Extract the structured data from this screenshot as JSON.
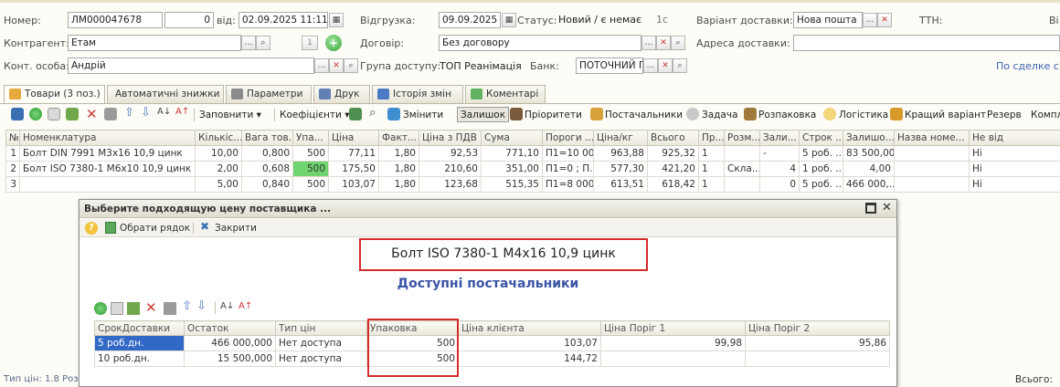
{
  "header": {
    "number_label": "Номер:",
    "number_value": "ЛМ000047678",
    "number_counter": "0",
    "date_label": "від:",
    "date_value": "02.09.2025 11:11:52",
    "shipment_label": "Відгрузка:",
    "shipment_value": "09.09.2025",
    "status_label": "Статус:",
    "status_value": "Новий / є немає",
    "one_c": "1с",
    "delivery_variant_label": "Варіант доставки:",
    "delivery_variant_value": "Нова пошта",
    "ttn_label": "ТТН:",
    "right_cut_label": "Ві",
    "counterparty_label": "Контрагент:",
    "counterparty_value": "Етам",
    "counterparty_count": "1",
    "contract_label": "Договір:",
    "contract_value": "Без договору",
    "delivery_address_label": "Адреса доставки:",
    "delivery_address_value": "",
    "contact_label": "Конт. особа:",
    "contact_value": "Андрій",
    "access_group_label": "Група доступу:",
    "access_group_value": "ТОП Реанімація",
    "bank_label": "Банк:",
    "bank_value": "ПОТОЧНИЙ Г",
    "by_deal_link": "По сделке с п"
  },
  "tabs": [
    {
      "label": "Товари (3 поз.)",
      "active": true
    },
    {
      "label": "Автоматичні знижки"
    },
    {
      "label": "Параметри"
    },
    {
      "label": "Друк"
    },
    {
      "label": "Історія змін"
    },
    {
      "label": "Коментарі"
    }
  ],
  "toolbar": {
    "fill": "Заповнити ▾",
    "coefficients": "Коефіцієнти ▾",
    "change": "Змінити",
    "stock": "Залишок",
    "priorities": "Пріоритети",
    "suppliers": "Постачальники",
    "task": "Задача",
    "unpacking": "Розпаковка",
    "logistics": "Логістика",
    "best_variant": "Кращий варіант",
    "reserve": "Резерв",
    "completeness": "Компл"
  },
  "grid": {
    "columns": [
      "№",
      "Номенклатура",
      "Кількіс...",
      "Вага тов...",
      "Упа...",
      "Ціна",
      "Факт...",
      "Ціна з ПДВ",
      "Сума",
      "Пороги ...",
      "Ціна/кг",
      "Всього",
      "Пр...",
      "Розм...",
      "Зали...",
      "Строк ...",
      "Залишо...",
      "Назва номе...",
      "Не від"
    ],
    "rows": [
      [
        "1",
        "Болт DIN 7991 M3x16 10,9 цинк",
        "10,00",
        "0,800",
        "500",
        "77,11",
        "1,80",
        "92,53",
        "771,10",
        "П1=10 00...",
        "963,88",
        "925,32",
        "1",
        "",
        "-",
        "5 роб. ...",
        "83 500,00",
        "",
        "Ні"
      ],
      [
        "2",
        "Болт ISO 7380-1 M6x10 10,9 цинк",
        "2,00",
        "0,608",
        "500",
        "175,50",
        "1,80",
        "210,60",
        "351,00",
        "П1=0 ; П...",
        "577,30",
        "421,20",
        "1",
        "Скла...",
        "4",
        "1 роб. ...",
        "4,00",
        "",
        "Ні"
      ],
      [
        "3",
        "Болт ISO 7380-1 M4x16 10,9 цинк",
        "5,00",
        "0,840",
        "500",
        "103,07",
        "1,80",
        "123,68",
        "515,35",
        "П1=8 000...",
        "613,51",
        "618,42",
        "1",
        "",
        "0",
        "5 роб. ...",
        "466 000,...",
        "",
        "Ні"
      ]
    ]
  },
  "dialog": {
    "title": "Выберите подходящую цену поставщика ...",
    "select_row": "Обрати рядок",
    "close": "Закрити",
    "product_name": "Болт ISO 7380-1 M4x16 10,9 цинк",
    "suppliers_heading": "Доступні постачальники",
    "columns": [
      "СрокДоставки",
      "Остаток",
      "Тип цін",
      "Упаковка",
      "Ціна клієнта",
      "Ціна Поріг 1",
      "Ціна Поріг 2"
    ],
    "rows": [
      [
        "5 роб.дн.",
        "466 000,000",
        "Нет доступа",
        "500",
        "103,07",
        "99,98",
        "95,86"
      ],
      [
        "10 роб.дн.",
        "15 500,000",
        "Нет доступа",
        "500",
        "144,72",
        "",
        ""
      ]
    ]
  },
  "status": {
    "price_type": "Тип цін: 1.8 Розд",
    "total_label": "Всього:"
  },
  "colors": {
    "accent_green": "#6fd36f",
    "selection_blue": "#3169c6",
    "highlight_red": "#d42c2c",
    "heading_blue": "#3b55a6"
  }
}
